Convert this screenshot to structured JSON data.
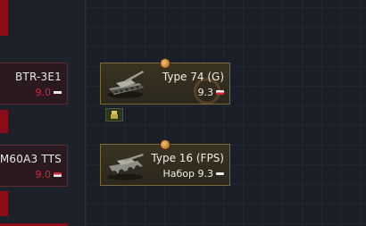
{
  "left_column": {
    "items": [
      {
        "name": "BTR-3E1",
        "br": "9.0"
      },
      {
        "name": "M60A3 TTS",
        "br": "9.0"
      }
    ]
  },
  "tree": {
    "vehicles": [
      {
        "name": "Type 74 (G)",
        "br": "9.3",
        "icon": "tank-icon"
      },
      {
        "name": "Type 16 (FPS)",
        "br": "Набор 9.3",
        "icon": "wheeled-vehicle-icon"
      }
    ],
    "sub_item_icon": "crew-member-icon"
  },
  "colors": {
    "red_br": "#d2263a",
    "card_border_gold": "#7a6a3b",
    "left_card_border": "#5a2a2e",
    "rank_orange": "#c07624"
  }
}
